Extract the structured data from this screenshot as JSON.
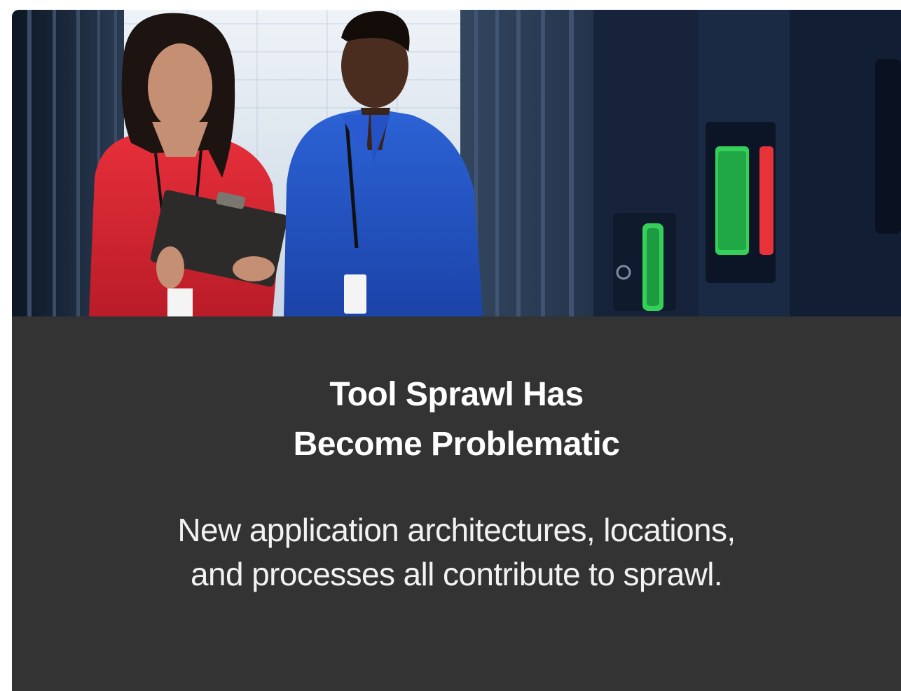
{
  "card": {
    "image": {
      "icon": "datacenter-photo",
      "colors": {
        "woman_shirt": "#d9222d",
        "man_shirt": "#1f4fbf",
        "server_racks": "#1c2a3e",
        "status_light_green": "#35d05a",
        "status_light_red": "#e8323a"
      }
    },
    "title_line1": "Tool Sprawl Has",
    "title_line2": "Become Problematic",
    "description_line1": "New application architectures, locations,",
    "description_line2": "and processes all contribute to sprawl.",
    "colors": {
      "background": "#333333",
      "text": "#ffffff"
    }
  }
}
